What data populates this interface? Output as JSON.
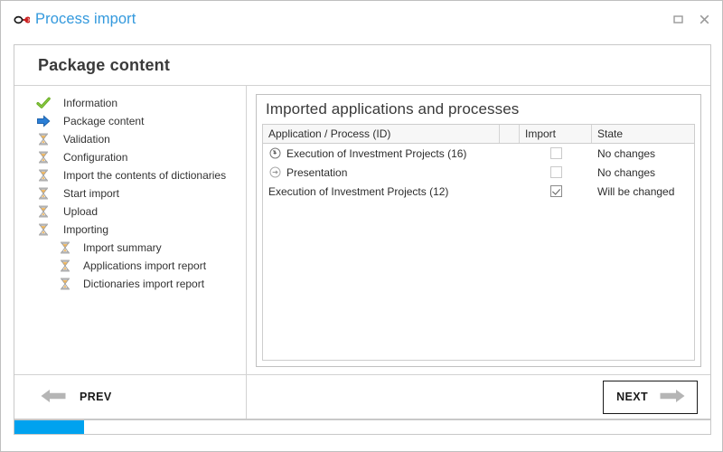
{
  "window": {
    "app_icon": "link-chain-icon",
    "title": "Process import",
    "controls": [
      {
        "name": "maximize-button",
        "glyph": "❐"
      },
      {
        "name": "close-button",
        "glyph": "✕"
      }
    ]
  },
  "panel": {
    "title": "Package content"
  },
  "sidebar": {
    "steps": [
      {
        "label": "Information",
        "icon": "check-icon",
        "state": "done",
        "indent": false
      },
      {
        "label": "Package content",
        "icon": "arrow-icon",
        "state": "current",
        "indent": false
      },
      {
        "label": "Validation",
        "icon": "hourglass-icon",
        "state": "pending",
        "indent": false
      },
      {
        "label": "Configuration",
        "icon": "hourglass-icon",
        "state": "pending",
        "indent": false
      },
      {
        "label": "Import the contents of dictionaries",
        "icon": "hourglass-icon",
        "state": "pending",
        "indent": false
      },
      {
        "label": "Start import",
        "icon": "hourglass-icon",
        "state": "pending",
        "indent": false
      },
      {
        "label": "Upload",
        "icon": "hourglass-icon",
        "state": "pending",
        "indent": false
      },
      {
        "label": "Importing",
        "icon": "hourglass-icon",
        "state": "pending",
        "indent": false
      },
      {
        "label": "Import summary",
        "icon": "hourglass-icon",
        "state": "pending",
        "indent": true
      },
      {
        "label": "Applications import report",
        "icon": "hourglass-icon",
        "state": "pending",
        "indent": true
      },
      {
        "label": "Dictionaries import report",
        "icon": "hourglass-icon",
        "state": "pending",
        "indent": true
      }
    ]
  },
  "main": {
    "heading": "Imported applications and processes",
    "table": {
      "columns": [
        "Application / Process (ID)",
        "",
        "Import",
        "State"
      ],
      "rows": [
        {
          "name": "Execution of Investment Projects (16)",
          "level": 1,
          "twisty": "circle-arrow-down-icon",
          "import_checked": false,
          "import_enabled": false,
          "state": "No changes"
        },
        {
          "name": "Presentation",
          "level": 2,
          "twisty": "circle-arrow-right-icon",
          "import_checked": false,
          "import_enabled": false,
          "state": "No changes"
        },
        {
          "name": "Execution of Investment Projects (12)",
          "level": 3,
          "twisty": "none",
          "import_checked": true,
          "import_enabled": true,
          "state": "Will be changed"
        }
      ]
    }
  },
  "footer": {
    "prev_label": "PREV",
    "prev_icon": "arrow-left-icon",
    "next_label": "NEXT",
    "next_icon": "arrow-right-icon"
  },
  "progress": {
    "percent": 10
  },
  "colors": {
    "accent": "#3399dd",
    "progress": "#00a2ef",
    "done": "#66aa22",
    "current": "#1f7fd4"
  }
}
